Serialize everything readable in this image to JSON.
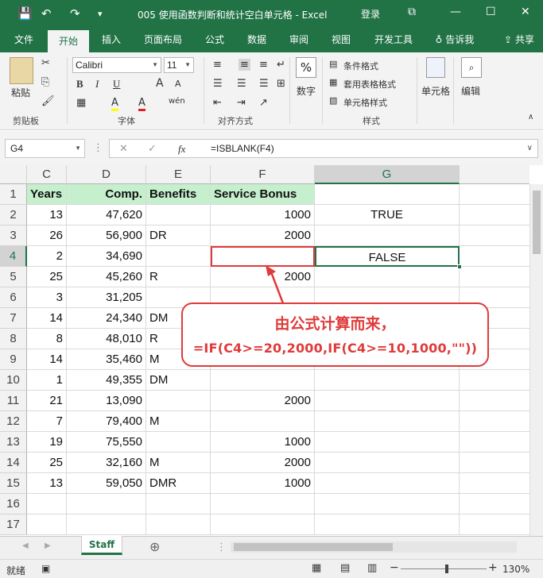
{
  "titlebar": {
    "title": "005 使用函数判断和统计空白单元格 - Excel",
    "login": "登录",
    "quick_access": {
      "save": "💾",
      "undo": "↶",
      "redo": "↷",
      "more": "▾"
    },
    "window_controls": {
      "restore": "⧉",
      "minimize": "—",
      "maximize": "☐",
      "close": "✕"
    }
  },
  "tabs": [
    "文件",
    "开始",
    "插入",
    "页面布局",
    "公式",
    "数据",
    "审阅",
    "视图",
    "开发工具"
  ],
  "tell_me": "告诉我",
  "share": "共享",
  "ribbon": {
    "clipboard": {
      "paste": "粘贴",
      "label": "剪贴板"
    },
    "font": {
      "name": "Calibri",
      "size": "11",
      "label": "字体",
      "bold": "B",
      "italic": "I",
      "underline": "U",
      "grow": "A",
      "shrink": "A",
      "fill": "A",
      "color": "A",
      "phonetic": "wén"
    },
    "alignment": {
      "label": "对齐方式"
    },
    "number": {
      "label": "数字",
      "symbol": "%"
    },
    "styles": {
      "conditional": "条件格式",
      "table": "套用表格格式",
      "cell_styles": "单元格样式",
      "label": "样式"
    },
    "cells": {
      "label": "单元格"
    },
    "editing": {
      "label": "编辑"
    }
  },
  "formula_bar": {
    "name_box": "G4",
    "cancel": "✕",
    "enter": "✓",
    "fx": "fx",
    "formula": "=ISBLANK(F4)"
  },
  "columns": [
    "C",
    "D",
    "E",
    "F",
    "G"
  ],
  "rows": [
    "1",
    "2",
    "3",
    "4",
    "5",
    "6",
    "7",
    "8",
    "9",
    "10",
    "11",
    "12",
    "13",
    "14",
    "15",
    "16",
    "17"
  ],
  "table": {
    "headers": {
      "C": "Years",
      "D": "Comp.",
      "E": "Benefits",
      "F": "Service Bonus"
    },
    "data": [
      {
        "C": "13",
        "D": "47,620",
        "E": "",
        "F": "1000",
        "G": "TRUE"
      },
      {
        "C": "26",
        "D": "56,900",
        "E": "DR",
        "F": "2000",
        "G": ""
      },
      {
        "C": "2",
        "D": "34,690",
        "E": "",
        "F": "",
        "G": "FALSE"
      },
      {
        "C": "25",
        "D": "45,260",
        "E": "R",
        "F": "2000",
        "G": ""
      },
      {
        "C": "3",
        "D": "31,205",
        "E": "",
        "F": "",
        "G": ""
      },
      {
        "C": "14",
        "D": "24,340",
        "E": "DM",
        "F": "",
        "G": ""
      },
      {
        "C": "8",
        "D": "48,010",
        "E": "R",
        "F": "",
        "G": ""
      },
      {
        "C": "14",
        "D": "35,460",
        "E": "M",
        "F": "",
        "G": ""
      },
      {
        "C": "1",
        "D": "49,355",
        "E": "DM",
        "F": "",
        "G": ""
      },
      {
        "C": "21",
        "D": "13,090",
        "E": "",
        "F": "2000",
        "G": ""
      },
      {
        "C": "7",
        "D": "79,400",
        "E": "M",
        "F": "",
        "G": ""
      },
      {
        "C": "19",
        "D": "75,550",
        "E": "",
        "F": "1000",
        "G": ""
      },
      {
        "C": "25",
        "D": "32,160",
        "E": "M",
        "F": "2000",
        "G": ""
      },
      {
        "C": "13",
        "D": "59,050",
        "E": "DMR",
        "F": "1000",
        "G": ""
      }
    ]
  },
  "annotation": {
    "line1": "由公式计算而来，",
    "line2": "=IF(C4>=20,2000,IF(C4>=10,1000,\"\"))"
  },
  "sheet_tabs": {
    "active": "Staff",
    "add": "⊕"
  },
  "status": {
    "ready": "就绪",
    "zoom": "130%"
  },
  "colors": {
    "accent": "#217346",
    "header_fill": "#c6efce",
    "annotation": "#e03a3a"
  }
}
